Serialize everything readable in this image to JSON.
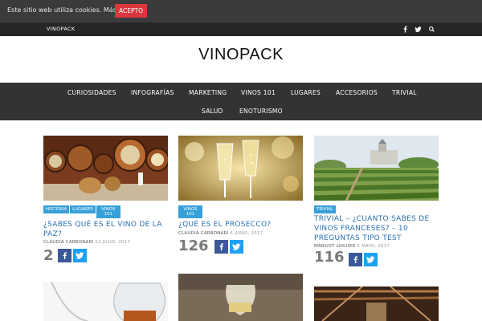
{
  "cookie": {
    "text": "Este sitio web utiliza cookies.",
    "more": "Más info",
    "accept": "ACEPTO"
  },
  "topbar": {
    "brand": "VINOPACK",
    "icons": [
      "facebook-icon",
      "twitter-icon",
      "search-icon"
    ]
  },
  "header": {
    "logo": "VINOPACK"
  },
  "nav": {
    "items": [
      "CURIOSIDADES",
      "INFOGRAFÍAS",
      "MARKETING",
      "VINOS 101",
      "LUGARES",
      "ACCESORIOS",
      "TRIVIAL",
      "SALUD",
      "ENOTURISMO"
    ]
  },
  "posts": [
    {
      "tags": [
        "HISTORIA",
        "LUGARES",
        "VINOS 101"
      ],
      "title": "¿SABES QUÉ ES EL VINO DE LA PAZ?",
      "author": "CLAUDIA CARBONARI",
      "date": "12 JULIO, 2017",
      "shares": "2"
    },
    {
      "tags": [
        "VINOS 101"
      ],
      "title": "¿QUÉ ES EL PROSECCO?",
      "author": "CLAUDIA CARBONARI",
      "date": "6 JUNIO, 2017",
      "shares": "126"
    },
    {
      "tags": [
        "TRIVIAL"
      ],
      "title": "TRIVIAL – ¿CUÁNTO SABES DE VINOS FRANCESES? – 10 PREGUNTAS TIPO TEST",
      "author": "MARGOT LOGUER",
      "date": "5 MAYO, 2017",
      "shares": "116"
    }
  ]
}
